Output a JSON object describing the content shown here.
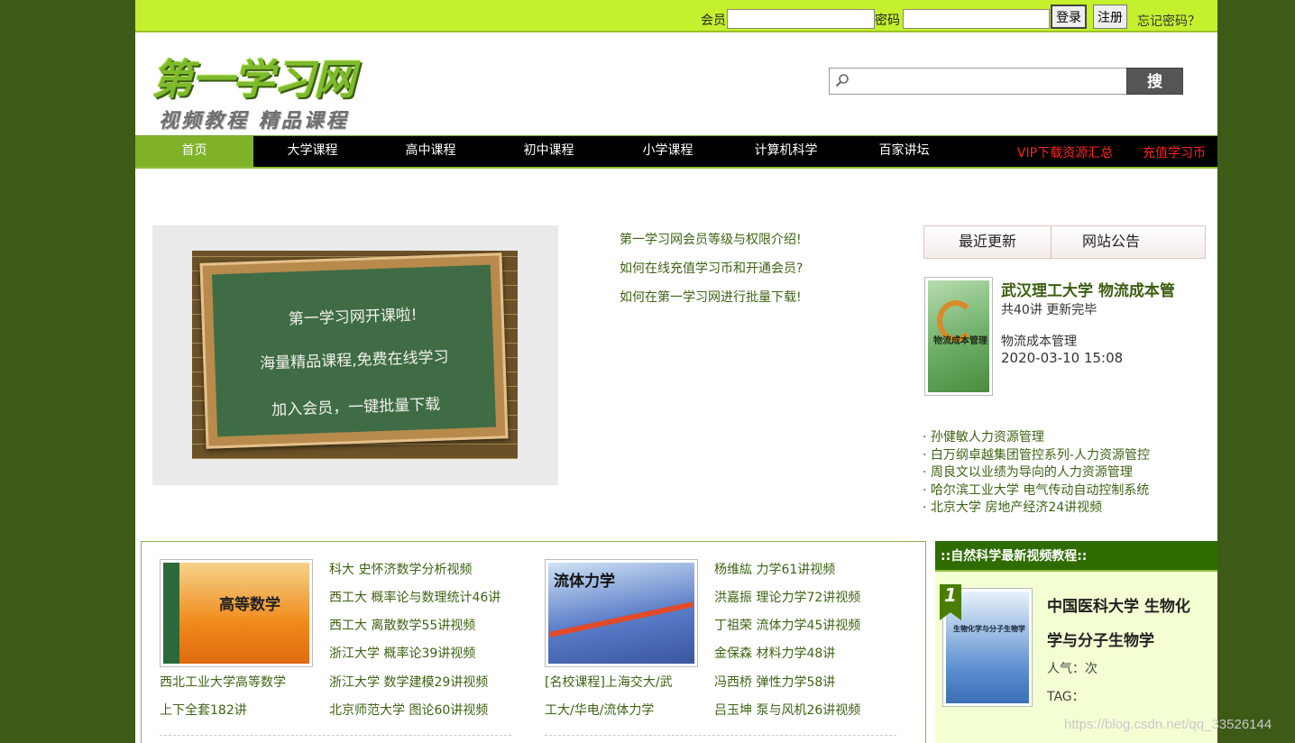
{
  "login": {
    "member_label": "会员",
    "member_value": "",
    "password_label": "密码",
    "password_value": "",
    "login_button": "登录",
    "register_button": "注册",
    "forgot_link": "忘记密码？"
  },
  "header": {
    "logo_line1": "第一学习网",
    "logo_line2": "视频教程 精品课程",
    "search_value": "",
    "search_button": "搜 索"
  },
  "nav": {
    "items": [
      "首页",
      "大学课程",
      "高中课程",
      "初中课程",
      "小学课程",
      "计算机科学",
      "百家讲坛"
    ],
    "vip": "VIP下载资源汇总",
    "recharge": "充值学习币"
  },
  "banner": {
    "line1": "第一学习网开课啦!",
    "line2": "海量精品课程,免费在线学习",
    "line3": "加入会员，一键批量下载"
  },
  "notices": [
    "第一学习网会员等级与权限介绍!",
    "如何在线充值学习币和开通会员?",
    "如何在第一学习网进行批量下载!"
  ],
  "tabs": [
    "最近更新",
    "网站公告"
  ],
  "latest": {
    "cover_title": "物流成本管理",
    "title": "武汉理工大学 物流成本管",
    "lessons": "共40讲 更新完毕",
    "name": "物流成本管理",
    "datetime": "2020-03-10 15:08"
  },
  "recent_list": [
    "· 孙健敏人力资源管理",
    "· 白万纲卓越集团管控系列-人力资源管控",
    "· 周良文以业绩为导向的人力资源管理",
    "· 哈尔滨工业大学 电气传动自动控制系统",
    "· 北京大学 房地产经济24讲视频"
  ],
  "math_block": {
    "cover_title": "高等数学",
    "caption_line1": "西北工业大学高等数学",
    "caption_line2": "上下全套182讲",
    "links": [
      "科大 史怀济数学分析视频",
      "西工大 概率论与数理统计46讲",
      "西工大 离散数学55讲视频",
      "浙江大学 概率论39讲视频",
      "浙江大学 数学建模29讲视频",
      "北京师范大学 图论60讲视频"
    ]
  },
  "fluid_block": {
    "cover_title": "流体力学",
    "caption_line1": "[名校课程]上海交大/武",
    "caption_line2": "工大/华电/流体力学",
    "links": [
      "杨维紘 力学61讲视频",
      "洪嘉振 理论力学72讲视频",
      "丁祖荣 流体力学45讲视频",
      "金保森 材料力学48讲",
      "冯西桥 弹性力学58讲",
      "吕玉坤 泵与风机26讲视频"
    ]
  },
  "natural_science": {
    "header": "::自然科学最新视频教程::",
    "badge": "1",
    "title_line1": "中国医科大学 生物化",
    "title_line2": "学与分子生物学",
    "popularity": "人气：次",
    "tag": "TAG：",
    "cover_title": "生物化学与分子生物学"
  },
  "watermark": "https://blog.csdn.net/qq_33526144",
  "colors": {
    "page_bg": "#3d5a17",
    "top_bar": "#c4f02e",
    "nav_active": "#80b229",
    "link": "#3f6314",
    "side_header": "#2e6c00"
  }
}
